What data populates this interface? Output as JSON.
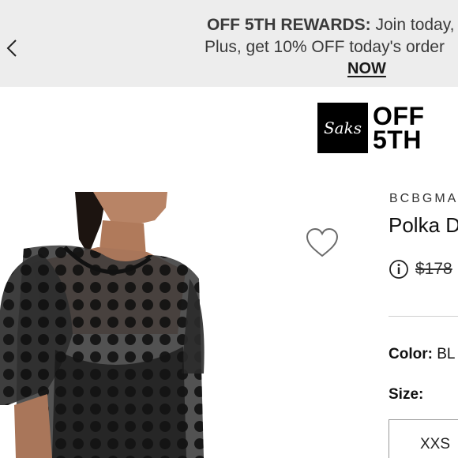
{
  "banner": {
    "title": "OFF 5TH REWARDS:",
    "line1_rest": " Join today,",
    "line2": "Plus, get 10% OFF today's order",
    "cta": "NOW",
    "prev_icon": "chevron-left-icon"
  },
  "logo": {
    "mark": "Saks",
    "text_line1": "OFF",
    "text_line2": "5TH"
  },
  "product": {
    "brand": "BCBGMA",
    "title": "Polka D",
    "price_original": "$178",
    "color_label": "Color:",
    "color_value": "BL",
    "size_label": "Size:",
    "sizes": [
      "XXS"
    ],
    "wishlist_icon": "heart-icon",
    "info_icon": "info-icon"
  },
  "colors": {
    "banner_bg": "#ededed",
    "logo_bg": "#000000",
    "text": "#1a1a1a"
  }
}
